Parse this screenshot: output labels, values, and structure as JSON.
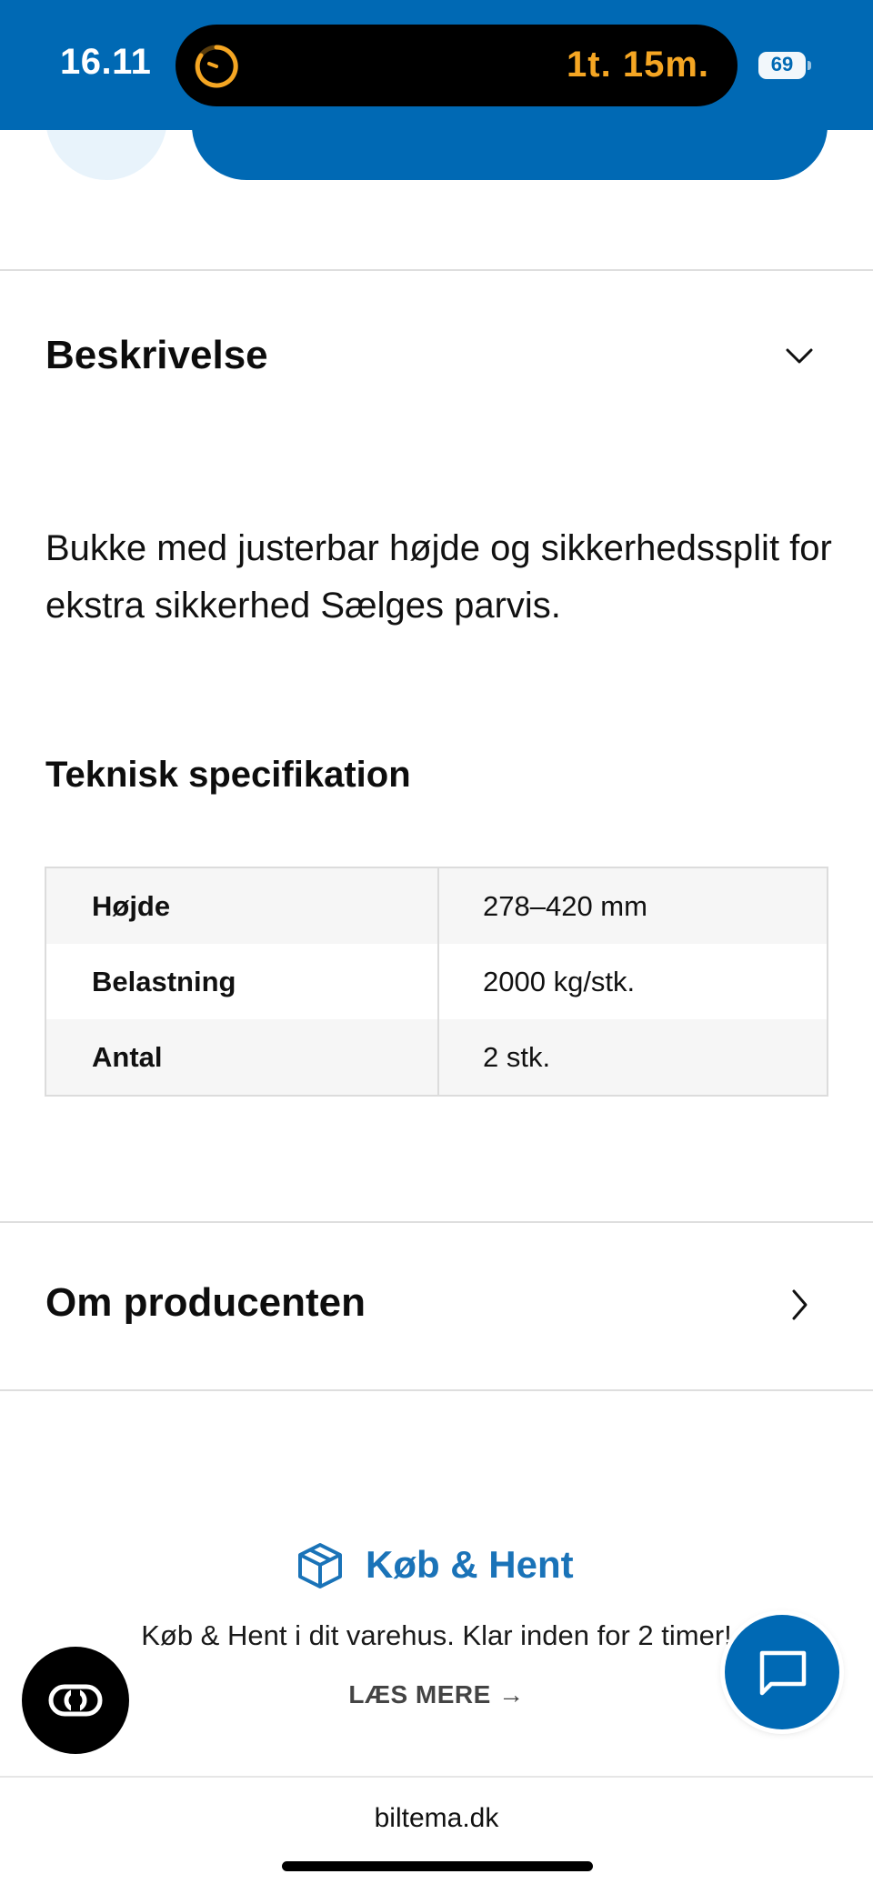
{
  "status_bar": {
    "time": "16.11",
    "timer": "1t. 15m.",
    "battery": "69",
    "timer_color": "#f5a623"
  },
  "description": {
    "title": "Beskrivelse",
    "text": "Bukke med justerbar højde og sikkerhedssplit for ekstra sikkerhed Sælges parvis."
  },
  "tech_spec": {
    "title": "Teknisk specifikation",
    "rows": [
      {
        "label": "Højde",
        "value": "278–420 mm"
      },
      {
        "label": "Belastning",
        "value": "2000 kg/stk."
      },
      {
        "label": "Antal",
        "value": "2 stk."
      }
    ]
  },
  "producer": {
    "title": "Om producenten"
  },
  "promo": {
    "title": "Køb & Hent",
    "text": "Køb & Hent i dit varehus. Klar inden for 2 timer!",
    "link": "LÆS MERE →"
  },
  "browser": {
    "domain": "biltema.dk"
  },
  "colors": {
    "brand_blue": "#0069b4",
    "promo_blue": "#1a73b8"
  },
  "icons": {
    "description_toggle": "chevron-down-icon",
    "producer_toggle": "chevron-right-icon",
    "promo": "box-icon",
    "chat": "chat-icon",
    "reader": "reader-icon"
  }
}
